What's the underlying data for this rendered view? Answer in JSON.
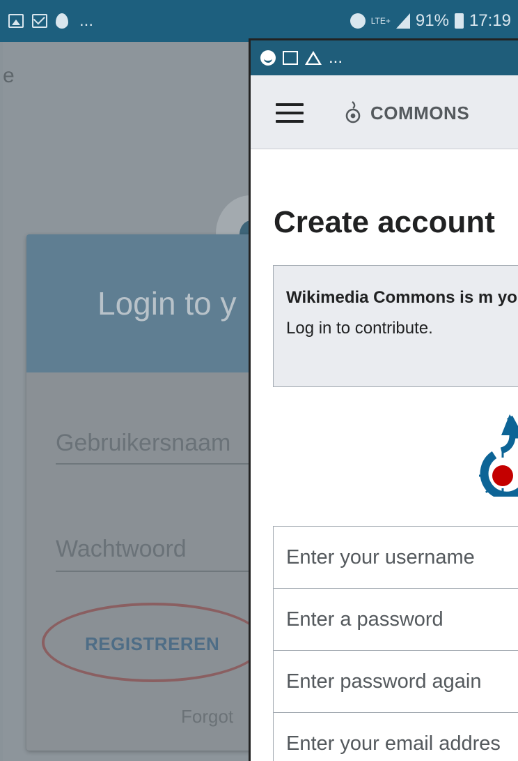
{
  "status_bar": {
    "battery": "91%",
    "time": "17:19",
    "network": "LTE+",
    "overflow": "..."
  },
  "background_app": {
    "title": "Login to y",
    "username_label": "Gebruikersnaam",
    "password_label": "Wachtwoord",
    "register_label": "REGISTREREN",
    "forgot_label": "Forgot",
    "edge_letter": "e"
  },
  "popup": {
    "status_overflow": "...",
    "app_name": "COMMONS",
    "page_title": "Create account",
    "notice_bold": "Wikimedia Commons is m you.",
    "notice_text": "Log in to contribute.",
    "fields": [
      {
        "placeholder": "Enter your username"
      },
      {
        "placeholder": "Enter a password"
      },
      {
        "placeholder": "Enter password again"
      },
      {
        "placeholder": "Enter your email addres"
      }
    ]
  },
  "colors": {
    "status_bar": "#1d5f7e",
    "appbar": "#eaecf0",
    "register_oval": "#8a5f61",
    "logo_blue": "#0d6496",
    "logo_red": "#c40000"
  }
}
